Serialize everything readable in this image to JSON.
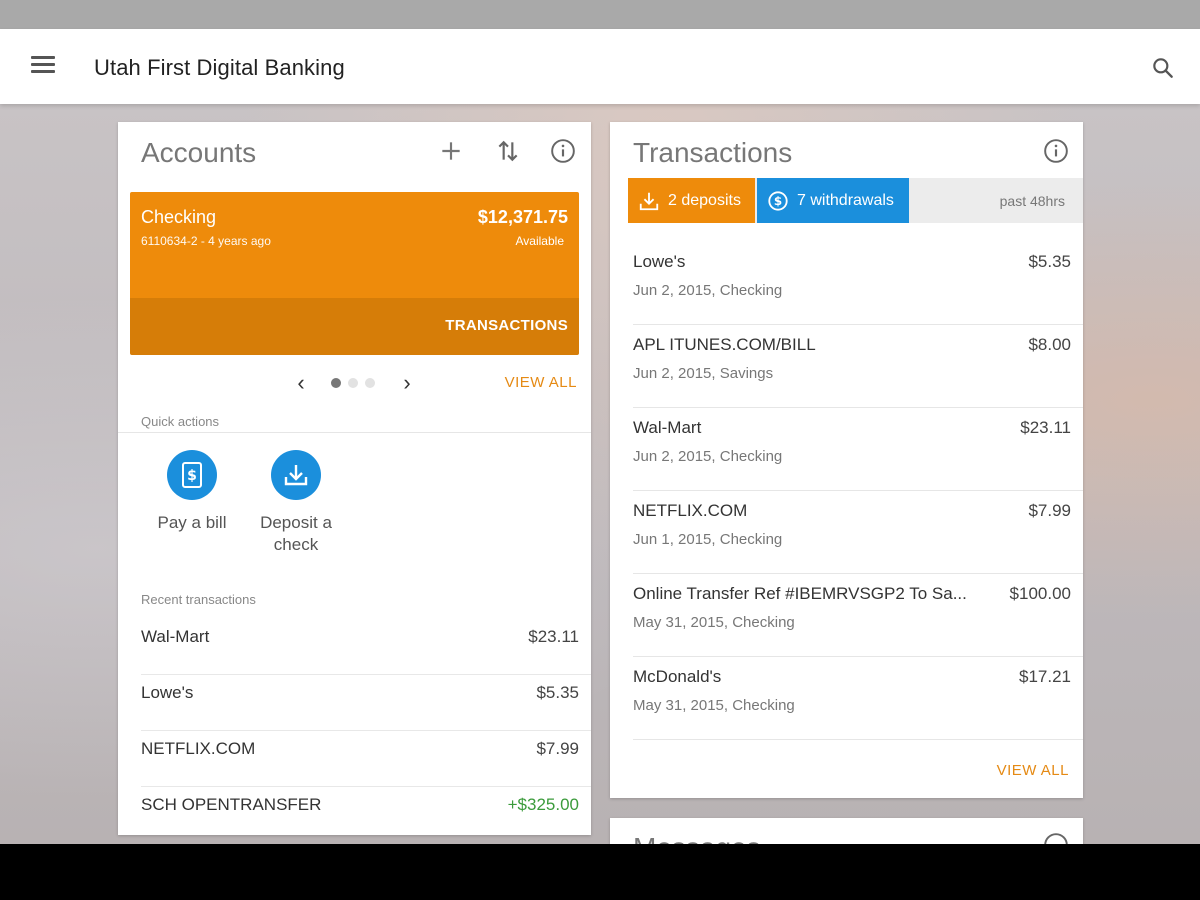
{
  "app": {
    "title": "Utah First Digital Banking",
    "menu_icon": "menu-icon",
    "search_icon": "search-icon"
  },
  "accounts": {
    "title": "Accounts",
    "account": {
      "name": "Checking",
      "number": "6110634-2 - 4 years ago",
      "balance": "$12,371.75",
      "balance_label": "Available",
      "transactions_label": "TRANSACTIONS",
      "color": "#ee8b0b"
    },
    "pager": {
      "pages": 3,
      "current": 1
    },
    "view_all": "VIEW ALL",
    "quick_actions_label": "Quick actions",
    "quick_actions": [
      {
        "label": "Pay a bill",
        "icon": "bill-icon"
      },
      {
        "label": "Deposit a check",
        "icon": "deposit-icon"
      }
    ],
    "recent_label": "Recent transactions",
    "recent": [
      {
        "name": "Wal-Mart",
        "amount": "$23.11",
        "credit": false
      },
      {
        "name": "Lowe's",
        "amount": "$5.35",
        "credit": false
      },
      {
        "name": "NETFLIX.COM",
        "amount": "$7.99",
        "credit": false
      },
      {
        "name": "SCH OPENTRANSFER",
        "amount": "+$325.00",
        "credit": true
      }
    ]
  },
  "transactions": {
    "title": "Transactions",
    "deposits_chip": "2 deposits",
    "withdrawals_chip": "7 withdrawals",
    "period": "past 48hrs",
    "deposit_color": "#ee8b0b",
    "withdrawal_color": "#1b8fdc",
    "items": [
      {
        "name": "Lowe's",
        "meta": "Jun 2, 2015, Checking",
        "amount": "$5.35"
      },
      {
        "name": "APL ITUNES.COM/BILL",
        "meta": "Jun 2, 2015, Savings",
        "amount": "$8.00"
      },
      {
        "name": "Wal-Mart",
        "meta": "Jun 2, 2015, Checking",
        "amount": "$23.11"
      },
      {
        "name": "NETFLIX.COM",
        "meta": "Jun 1, 2015, Checking",
        "amount": "$7.99"
      },
      {
        "name": "Online Transfer Ref #IBEMRVSGP2 To Sa...",
        "meta": "May 31, 2015, Checking",
        "amount": "$100.00"
      },
      {
        "name": "McDonald's",
        "meta": "May 31, 2015, Checking",
        "amount": "$17.21"
      }
    ],
    "view_all": "VIEW ALL"
  },
  "messages": {
    "title": "Messages"
  }
}
